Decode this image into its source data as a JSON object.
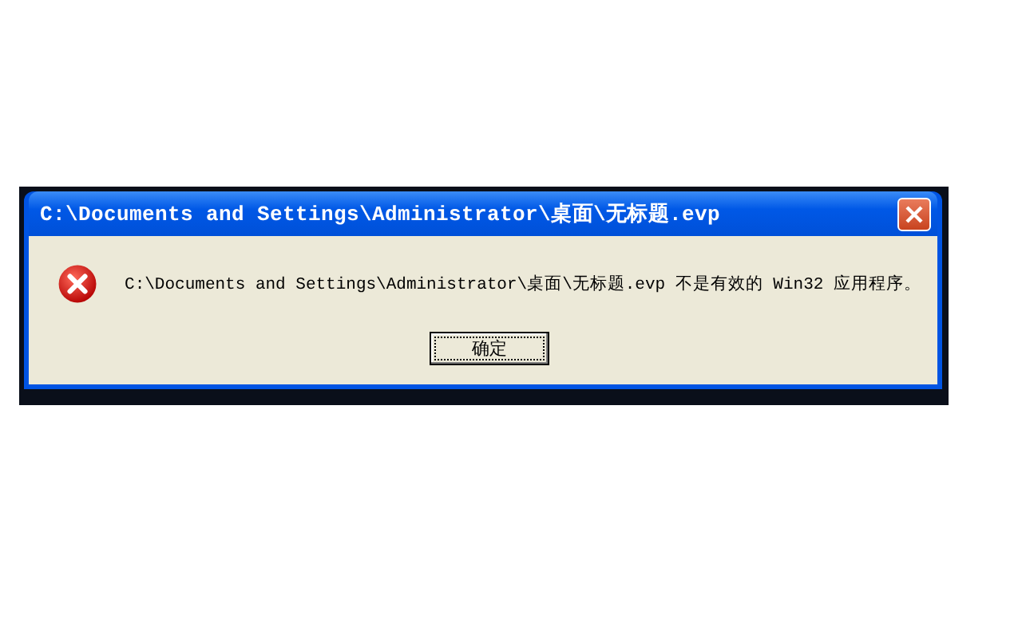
{
  "window": {
    "title": "C:\\Documents and Settings\\Administrator\\桌面\\无标题.evp"
  },
  "message": "C:\\Documents and Settings\\Administrator\\桌面\\无标题.evp 不是有效的 Win32 应用程序。",
  "buttons": [
    {
      "label": "确定",
      "selected": true
    }
  ]
}
